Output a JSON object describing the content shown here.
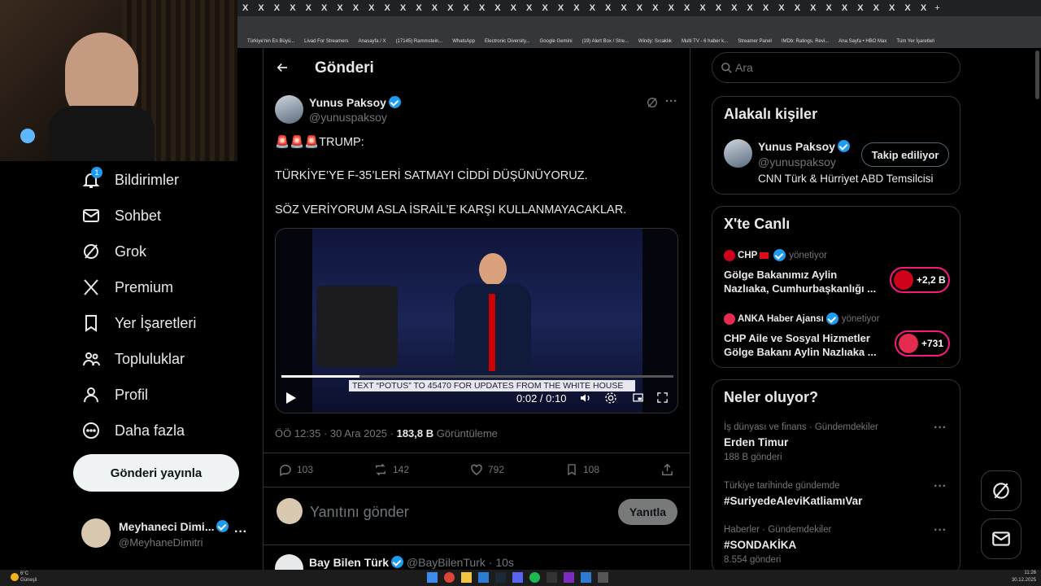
{
  "browser": {
    "tab_glyph": "X",
    "new_tab": "+",
    "bookmarks": [
      "Türkiye'nin En Büyü...",
      "Livad For Streamers",
      "Anasayfa / X",
      "(17145) Rammstein...",
      "WhatsApp",
      "Electronic Diversity...",
      "Google Gemini",
      "(19) Alert Box / Stre...",
      "Windy: Sıcaklık",
      "Multi TV - 6 haber k...",
      "Streamer Panel",
      "IMDb: Ratings, Revi...",
      "Ana Sayfa • HBO Max",
      "Tüm Yer İşaretleri"
    ]
  },
  "nav": {
    "notif_badge": "1",
    "items": [
      "Bildirimler",
      "Sohbet",
      "Grok",
      "Premium",
      "Yer İşaretleri",
      "Topluluklar",
      "Profil",
      "Daha fazla"
    ],
    "post_button": "Gönderi yayınla",
    "account_name": "Meyhaneci Dimi...",
    "account_handle": "@MeyhaneDimitri",
    "account_more": "···"
  },
  "post": {
    "header_title": "Gönderi",
    "author_name": "Yunus Paksoy",
    "author_handle": "@yunuspaksoy",
    "line1": "🚨🚨🚨TRUMP:",
    "line2": "TÜRKİYE’YE F-35’LERİ SATMAYI CİDDİ DÜŞÜNÜYORUZ.",
    "line3": "SÖZ VERİYORUM ASLA İSRAİL’E KARŞI KULLANMAYACAKLAR.",
    "video_caption": "TEXT “POTUS” TO 45470 FOR UPDATES FROM THE WHITE HOUSE",
    "video_time": "0:02 / 0:10",
    "video_progress": 0.2,
    "meta_time": "ÖÖ 12:35 · 30 Ara 2025 · ",
    "views": "183,8 B",
    "views_label": "Görüntüleme",
    "replies": "103",
    "reposts": "142",
    "likes": "792",
    "bookmarks": "108",
    "reply_placeholder": "Yanıtını gönder",
    "reply_button": "Yanıtla",
    "next_name": "Bay Bilen Türk",
    "next_handle": "@BayBilenTurk",
    "next_time": "· 10s"
  },
  "search": {
    "placeholder": "Ara"
  },
  "related": {
    "title": "Alakalı kişiler",
    "name": "Yunus Paksoy",
    "handle": "@yunuspaksoy",
    "bio": "CNN Türk & Hürriyet ABD Temsilcisi",
    "follow_button": "Takip ediliyor"
  },
  "live": {
    "title": "X'te Canlı",
    "items": [
      {
        "host": "CHP",
        "status": "yönetiyor",
        "text1": "Gölge Bakanımız Aylin",
        "text2": "Nazlıaka, Cumhurbaşkanlığı ...",
        "count": "+2,2 B"
      },
      {
        "host": "ANKA Haber Ajansı",
        "status": "yönetiyor",
        "text1": "CHP Aile ve Sosyal Hizmetler",
        "text2": "Gölge Bakanı Aylin Nazlıaka ...",
        "count": "+731"
      }
    ]
  },
  "trends": {
    "title": "Neler oluyor?",
    "items": [
      {
        "context": "İş dünyası ve finans · Gündemdekiler",
        "name": "Erden Timur",
        "count": "188 B gönderi"
      },
      {
        "context": "Türkiye tarihinde gündemde",
        "name": "#SuriyedeAleviKatliamıVar",
        "count": ""
      },
      {
        "context": "Haberler · Gündemdekiler",
        "name": "#SONDAKİKA",
        "count": "8.554 gönderi"
      }
    ]
  },
  "taskbar": {
    "temp": "6°C",
    "weather": "Güneşli",
    "time": "11:26",
    "date": "30.12.2025"
  },
  "colors": {
    "accent": "#1d9bf0",
    "live": "#f91880",
    "bg": "#000000",
    "border": "#2f3336"
  }
}
